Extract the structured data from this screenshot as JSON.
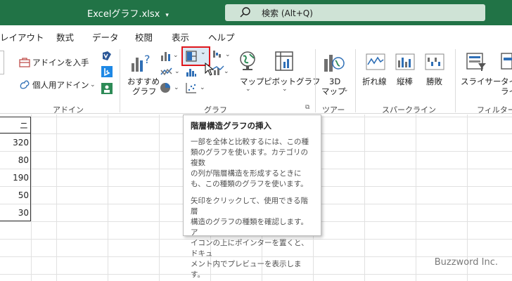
{
  "window": {
    "filename": "Excelグラフ.xlsx",
    "search_label": "検索 (Alt+Q)",
    "accent": "#217346"
  },
  "menu": {
    "tabs": [
      "レイアウト",
      "数式",
      "データ",
      "校閲",
      "表示",
      "ヘルプ"
    ]
  },
  "ribbon": {
    "addin": {
      "get_addins": "アドインを入手",
      "my_addins": "個人用アドイン",
      "group_label": "アドイン"
    },
    "charts": {
      "recommended_line1": "おすすめ",
      "recommended_line2": "グラフ",
      "maps": "マップ",
      "pivotchart": "ピボットグラフ",
      "group_label": "グラフ"
    },
    "tours": {
      "map3d_line1": "3D",
      "map3d_line2": "マップ",
      "group_label": "ツアー"
    },
    "sparklines": {
      "line": "折れ線",
      "column": "縦棒",
      "winloss": "勝敗",
      "group_label": "スパークライン"
    },
    "filters": {
      "slicer": "スライサー",
      "timeline": "タイ",
      "timeline2": "ライ",
      "group_label": "フィルター"
    }
  },
  "sheet": {
    "header_partial": "ニ",
    "values": [
      "320",
      "80",
      "190",
      "50",
      "30"
    ]
  },
  "tooltip": {
    "title": "階層構造グラフの挿入",
    "para1": [
      "一部を全体と比較するには、この種",
      "類のグラフを使います。カテゴリの複数",
      "の列が階層構造を形成するときに",
      "も、この種類のグラフを使います。"
    ],
    "para2": [
      "矢印をクリックして、使用できる階層",
      "構造のグラフの種類を確認します。ア",
      "イコンの上にポインターを置くと、ドキュ",
      "メント内でプレビューを表示します。"
    ]
  },
  "watermark": "Buzzword Inc.",
  "icons": [
    "search-icon",
    "store-icon",
    "my-addins-icon",
    "visio-icon",
    "bing-icon",
    "people-icon",
    "recommended-charts-icon",
    "column-chart-icon",
    "hierarchy-chart-icon",
    "waterfall-chart-icon",
    "line-chart-icon",
    "statistic-chart-icon",
    "combo-chart-icon",
    "pie-chart-icon",
    "scatter-chart-icon",
    "maps-icon",
    "pivotchart-icon",
    "3d-map-icon",
    "sparkline-line-icon",
    "sparkline-column-icon",
    "sparkline-winloss-icon",
    "slicer-icon",
    "timeline-icon",
    "mouse-cursor-icon"
  ]
}
